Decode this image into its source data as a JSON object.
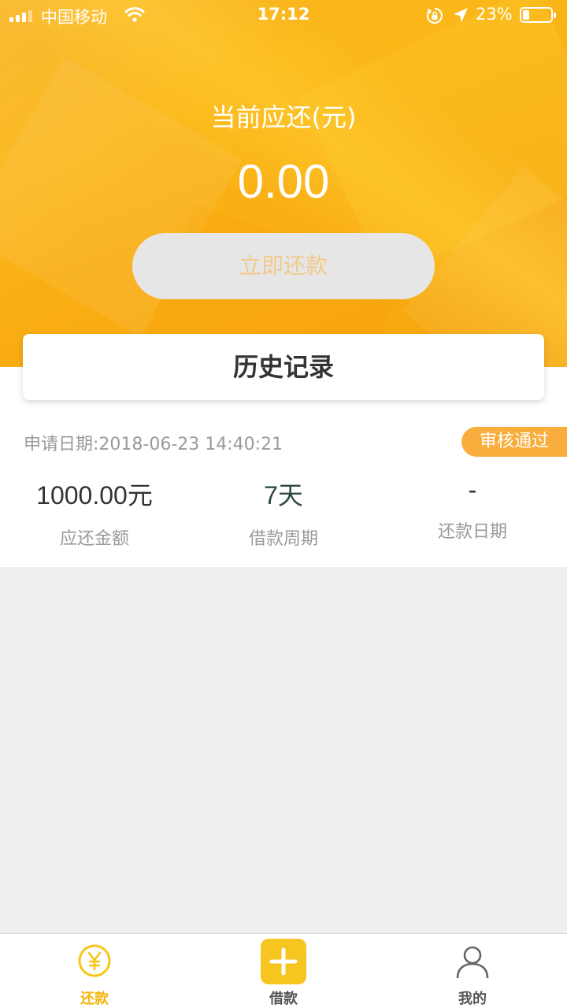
{
  "status_bar": {
    "carrier": "中国移动",
    "time": "17:12",
    "battery": "23%",
    "battery_level": 0.23
  },
  "summary": {
    "label": "当前应还(元)",
    "amount": "0.00",
    "repay_button": "立即还款"
  },
  "history_title": "历史记录",
  "record": {
    "apply_date": "申请日期:2018-06-23 14:40:21",
    "status": "审核通过",
    "amount_value": "1000.00元",
    "amount_label": "应还金额",
    "period_value": "7天",
    "period_label": "借款周期",
    "repay_date_value": "-",
    "repay_date_label": "还款日期"
  },
  "tabs": [
    {
      "label": "还款",
      "icon": "yen-circle-icon",
      "active": true
    },
    {
      "label": "借款",
      "icon": "plus-icon",
      "active": false
    },
    {
      "label": "我的",
      "icon": "person-icon",
      "active": false
    }
  ],
  "colors": {
    "accent": "#f5b50e",
    "header": "#f9ae13",
    "badge": "#f8ad3c"
  }
}
